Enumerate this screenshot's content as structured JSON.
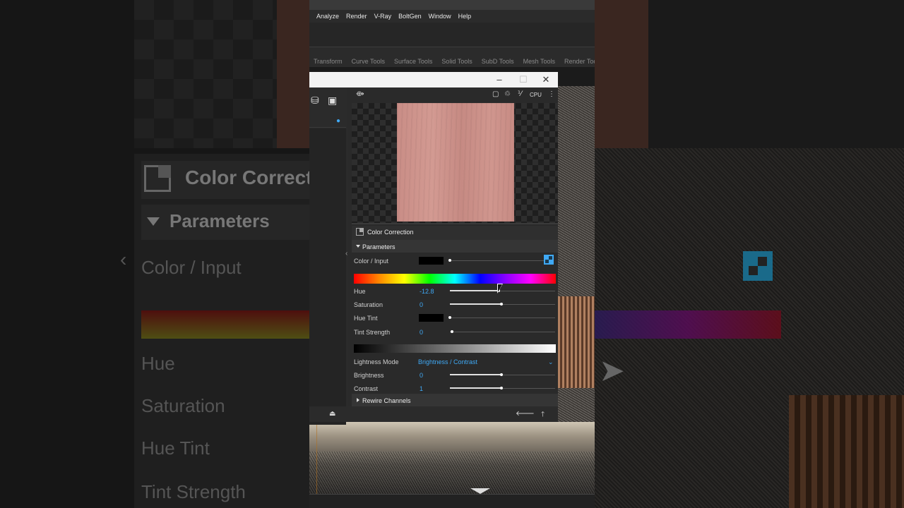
{
  "menu": [
    "Analyze",
    "Render",
    "V-Ray",
    "BoltGen",
    "Window",
    "Help"
  ],
  "shelf_tabs": [
    "Transform",
    "Curve Tools",
    "Surface Tools",
    "Solid Tools",
    "SubD Tools",
    "Mesh Tools",
    "Render Tools"
  ],
  "window": {
    "minimize": "–",
    "maximize": "☐",
    "close": "✕",
    "engine": "CPU"
  },
  "background": {
    "title": "Color Correctio",
    "params": "Parameters",
    "labels": [
      "Color / Input",
      "Hue",
      "Saturation",
      "Hue Tint",
      "Tint Strength"
    ]
  },
  "panel": {
    "title": "Color Correction",
    "section": "Parameters",
    "color_input_label": "Color / Input",
    "hue_label": "Hue",
    "hue_value": "-12.8",
    "saturation_label": "Saturation",
    "saturation_value": "0",
    "hue_tint_label": "Hue Tint",
    "tint_strength_label": "Tint Strength",
    "tint_strength_value": "0",
    "lightness_mode_label": "Lightness Mode",
    "lightness_mode_value": "Brightness / Contrast",
    "brightness_label": "Brightness",
    "brightness_value": "0",
    "contrast_label": "Contrast",
    "contrast_value": "1",
    "rewire": "Rewire Channels"
  },
  "colors": {
    "accent": "#3fa9f5",
    "swatch": "#cc938b"
  }
}
